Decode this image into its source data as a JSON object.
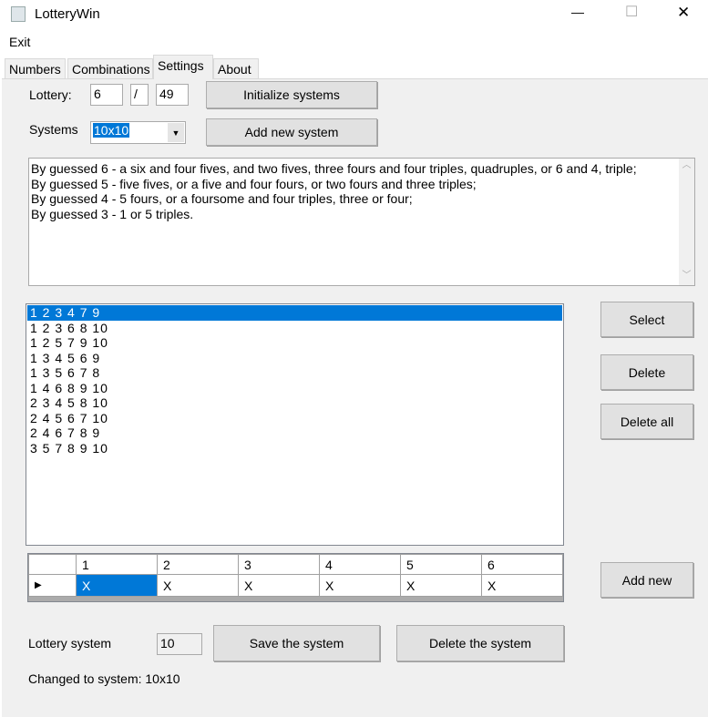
{
  "window": {
    "title": "LotteryWin",
    "minimize": "—",
    "maximize": "☐",
    "close": "✕"
  },
  "menu": {
    "exit": "Exit"
  },
  "tabs": [
    "Numbers",
    "Combinations",
    "Settings",
    "About"
  ],
  "settings": {
    "lottery_label": "Lottery:",
    "lottery_k": "6",
    "separator": "/",
    "lottery_n": "49",
    "initialize_button": "Initialize systems",
    "systems_label": "Systems",
    "systems_value": "10x10",
    "add_new_system_button": "Add new system",
    "description": [
      "By guessed 6 - a six and four fives, and two fives, three fours and four triples, quadruples, or 6 and 4, triple;",
      "By guessed 5 - five fives, or a five and four fours, or two fours and three triples;",
      "By guessed 4 - 5 fours, or a foursome and four triples, three or four;",
      "By guessed 3 - 1 or 5 triples."
    ],
    "combinations": [
      "1 2 3 4 7 9",
      "1 2 3 6 8 10",
      "1 2 5 7 9 10",
      "1 3 4 5 6 9",
      "1 3 5 6 7 8",
      "1 4 6 8 9 10",
      "2 3 4 5 8 10",
      "2 4 5 6 7 10",
      "2 4 6 7 8 9",
      "3 5 7 8 9 10"
    ],
    "select_button": "Select",
    "delete_button": "Delete",
    "delete_all_button": "Delete all",
    "add_new_button": "Add new",
    "grid": {
      "columns": [
        "1",
        "2",
        "3",
        "4",
        "5",
        "6"
      ],
      "row": [
        "X",
        "X",
        "X",
        "X",
        "X",
        "X"
      ],
      "row_marker": "▶"
    },
    "lottery_system_label": "Lottery system",
    "lottery_system_value": "10",
    "save_button": "Save the system",
    "delete_system_button": "Delete the system",
    "status": "Changed to system: 10x10"
  }
}
